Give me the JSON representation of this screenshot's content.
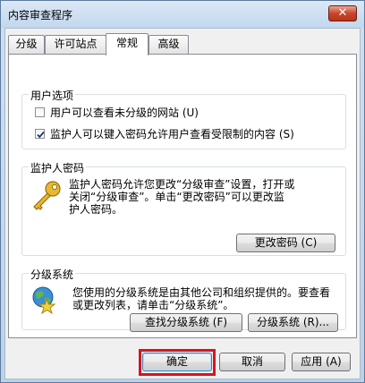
{
  "window": {
    "title": "内容审查程序",
    "close_label": "✕"
  },
  "tabs": [
    {
      "label": "分级"
    },
    {
      "label": "许可站点"
    },
    {
      "label": "常规",
      "active": true
    },
    {
      "label": "高级"
    }
  ],
  "user_options": {
    "legend": "用户选项",
    "options": [
      {
        "label": "用户可以查看未分级的网站 (U)",
        "checked": false
      },
      {
        "label": "监护人可以键入密码允许用户查看受限制的内容 (S)",
        "checked": true
      }
    ]
  },
  "supervisor_password": {
    "legend": "监护人密码",
    "description": [
      "监护人密码允许您更改“分级审查”设置，打开或",
      "关闭“分级审查”。单击“更改密码”可以更改监",
      "护人密码。"
    ],
    "change_button": "更改密码 (C)"
  },
  "rating_systems": {
    "legend": "分级系统",
    "description": [
      "您使用的分级系统是由其他公司和组织提供的。要查看",
      "或更改列表，请单击“分级系统”。"
    ],
    "find_button": "查找分级系统 (F)",
    "systems_button": "分级系统 (R)..."
  },
  "footer": {
    "ok_label": "确定",
    "cancel_label": "取消",
    "apply_label": "应用 (A)"
  }
}
